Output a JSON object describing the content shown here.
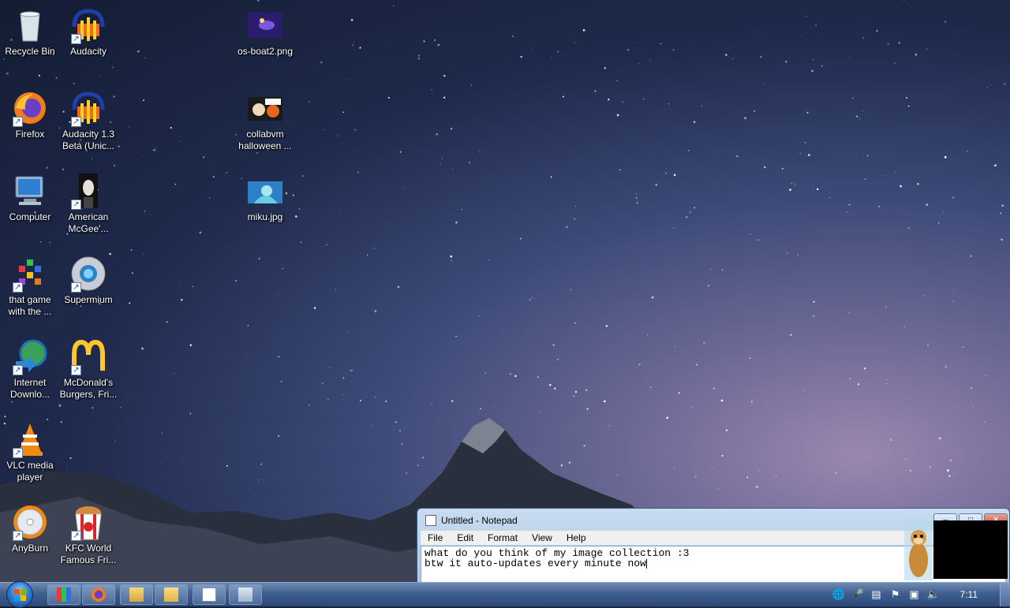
{
  "desktop": {
    "icons": [
      {
        "label": "Recycle Bin"
      },
      {
        "label": "Audacity"
      },
      {
        "label": "os-boat2.png"
      },
      {
        "label": "Firefox"
      },
      {
        "label": "Audacity 1.3 Beta (Unic..."
      },
      {
        "label": "collabvm halloween ..."
      },
      {
        "label": "Computer"
      },
      {
        "label": "American McGee'..."
      },
      {
        "label": "miku.jpg"
      },
      {
        "label": "that game with the ..."
      },
      {
        "label": "Supermium"
      },
      {
        "label": "Internet Downlo..."
      },
      {
        "label": "McDonald's Burgers, Fri..."
      },
      {
        "label": "VLC media player"
      },
      {
        "label": "AnyBurn"
      },
      {
        "label": "KFC World Famous Fri..."
      }
    ]
  },
  "notepad": {
    "title": "Untitled - Notepad",
    "menu": [
      "File",
      "Edit",
      "Format",
      "View",
      "Help"
    ],
    "lines": [
      "what do you think of my image collection :3",
      "btw it auto-updates every minute now"
    ],
    "controls": {
      "minimize": "–",
      "maximize": "□",
      "close": "✕"
    }
  },
  "taskbar": {
    "clock": "7:11",
    "pinned": [
      "game-icon",
      "firefox-icon",
      "file-explorer-icon",
      "folder-icon",
      "notepad-icon",
      "remote-desktop-icon"
    ]
  }
}
